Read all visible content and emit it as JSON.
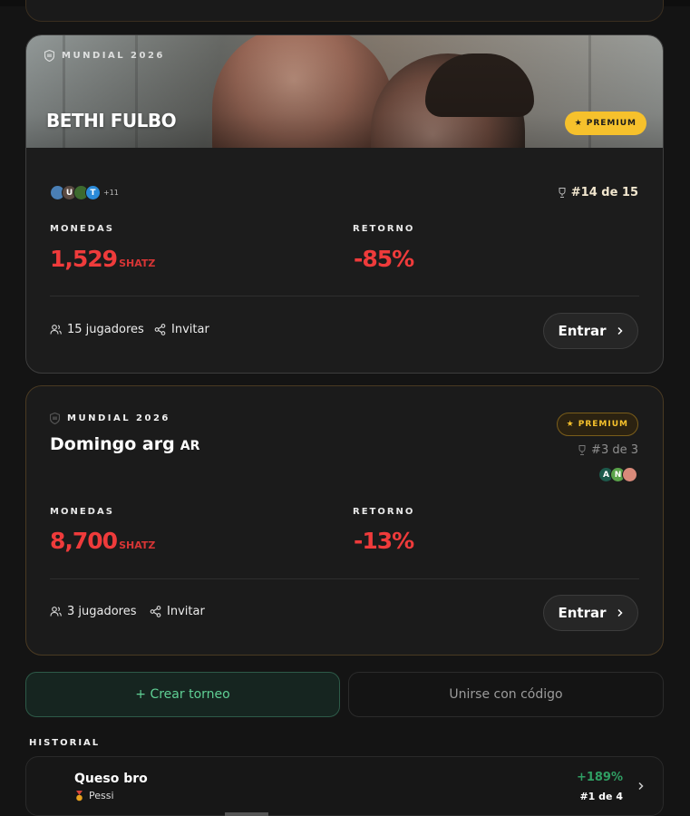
{
  "tournaments": [
    {
      "tag": "MUNDIAL 2026",
      "title": "BETHI FULBO",
      "premium": "PREMIUM",
      "avatars": [
        {
          "letter": "",
          "color": "#4a7fb5"
        },
        {
          "letter": "U",
          "color": "#5a4a42"
        },
        {
          "letter": "",
          "color": "#3d6a2e"
        },
        {
          "letter": "T",
          "color": "#2a8ad8"
        }
      ],
      "more": "+11",
      "rank": "#14 de 15",
      "coins_label": "MONEDAS",
      "coins": "1,529",
      "unit": "SHATZ",
      "return_label": "RETORNO",
      "return": "-85%",
      "players": "15 jugadores",
      "invite": "Invitar",
      "enter": "Entrar"
    },
    {
      "tag": "MUNDIAL 2026",
      "title": "Domingo arg",
      "flag": "AR",
      "premium": "PREMIUM",
      "rank": "#3 de 3",
      "avatars": [
        {
          "letter": "A",
          "color": "#1d5a4c"
        },
        {
          "letter": "N",
          "color": "#5aa34a"
        },
        {
          "letter": "",
          "color": "#d98a7a"
        }
      ],
      "coins_label": "MONEDAS",
      "coins": "8,700",
      "unit": "SHATZ",
      "return_label": "RETORNO",
      "return": "-13%",
      "players": "3 jugadores",
      "invite": "Invitar",
      "enter": "Entrar"
    }
  ],
  "actions": {
    "create": "+ Crear torneo",
    "join": "Unirse con código"
  },
  "history": {
    "label": "HISTORIAL",
    "items": [
      {
        "name": "Queso bro",
        "winner": "Pessi",
        "pct": "+189%",
        "rank": "#1 de 4"
      }
    ]
  },
  "colors": {
    "accent_gold": "#f6c12c",
    "negative": "#ef3b3b",
    "positive": "#2f9e63",
    "create_green": "#5fcf94"
  }
}
